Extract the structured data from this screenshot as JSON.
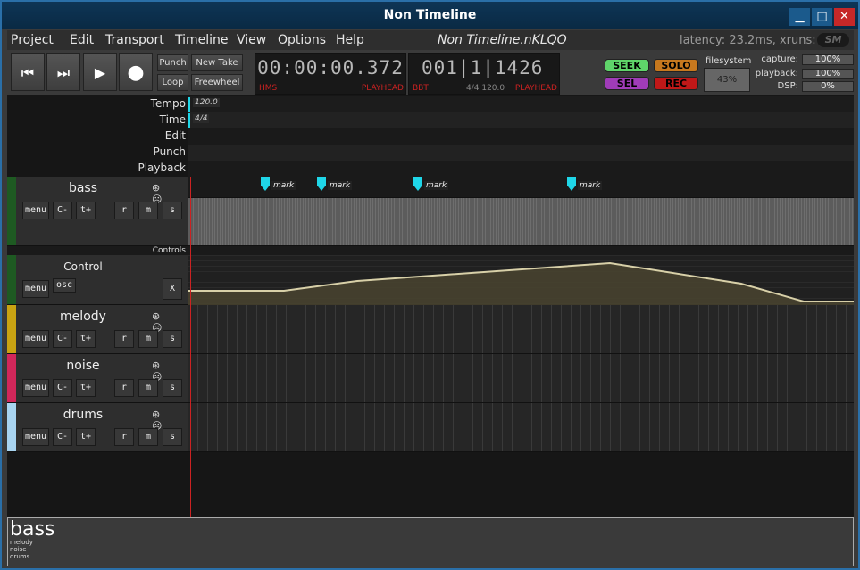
{
  "window": {
    "title": "Non Timeline",
    "min": "▁",
    "max": "□",
    "close": "✕"
  },
  "menu": {
    "items": [
      {
        "first": "P",
        "rest": "roject"
      },
      {
        "first": "E",
        "rest": "dit"
      },
      {
        "first": "T",
        "rest": "ransport"
      },
      {
        "first": "T",
        "rest": "imeline"
      },
      {
        "first": "V",
        "rest": "iew"
      },
      {
        "first": "O",
        "rest": "ptions"
      },
      {
        "first": "H",
        "rest": "elp"
      }
    ],
    "document": "Non Timeline.nKLQO",
    "latency": "latency: 23.2ms, xruns: 0",
    "sm": "SM"
  },
  "transport": {
    "rewind": "⏮",
    "ffwd": "⏭",
    "play": "▶",
    "record": "●",
    "punch": "Punch",
    "loop": "Loop",
    "new_take": "New Take",
    "freewheel": "Freewheel"
  },
  "clock_hms": {
    "value": "00:00:00.372",
    "label": "HMS",
    "mode": "PLAYHEAD"
  },
  "clock_bbt": {
    "value": "001|1|1426",
    "label": "BBT",
    "meta": "4/4 120.0",
    "mode": "PLAYHEAD"
  },
  "buttons": {
    "seek": "SEEK",
    "solo": "SOLO",
    "sel": "SEL",
    "rec": "REC"
  },
  "colors": {
    "seek": "#5fd46a",
    "solo": "#c7781e",
    "sel": "#a03cb8",
    "rec": "#c01818",
    "bass": "#1e5a22",
    "control": "#1e5a22",
    "melody": "#c9a312",
    "noise": "#d1275a",
    "drums": "#a8d4f0"
  },
  "filesystem": {
    "label": "filesystem",
    "value": "43%"
  },
  "meters": [
    {
      "label": "capture:",
      "value": "100%"
    },
    {
      "label": "playback:",
      "value": "100%"
    },
    {
      "label": "DSP:",
      "value": "0%"
    }
  ],
  "rulers": {
    "tempo": "Tempo",
    "time": "Time",
    "edit": "Edit",
    "punch": "Punch",
    "playback": "Playback",
    "tempo_value": "120.0",
    "time_value": "4/4"
  },
  "marks": [
    "mark",
    "mark",
    "mark",
    "mark"
  ],
  "controls_label": "Controls",
  "tracks": {
    "bass": {
      "name": "bass"
    },
    "melody": {
      "name": "melody"
    },
    "noise": {
      "name": "noise"
    },
    "drums": {
      "name": "drums"
    },
    "control": {
      "name": "Control",
      "menu": "menu",
      "osc": "osc",
      "close": "X"
    }
  },
  "track_buttons": {
    "menu": "menu",
    "c": "C-",
    "t": "t+",
    "r": "r",
    "m": "m",
    "s": "s",
    "rec_icons": "⊛ ☹"
  },
  "status": {
    "current": "bass",
    "list": [
      "melody",
      "noise",
      "drums"
    ]
  }
}
